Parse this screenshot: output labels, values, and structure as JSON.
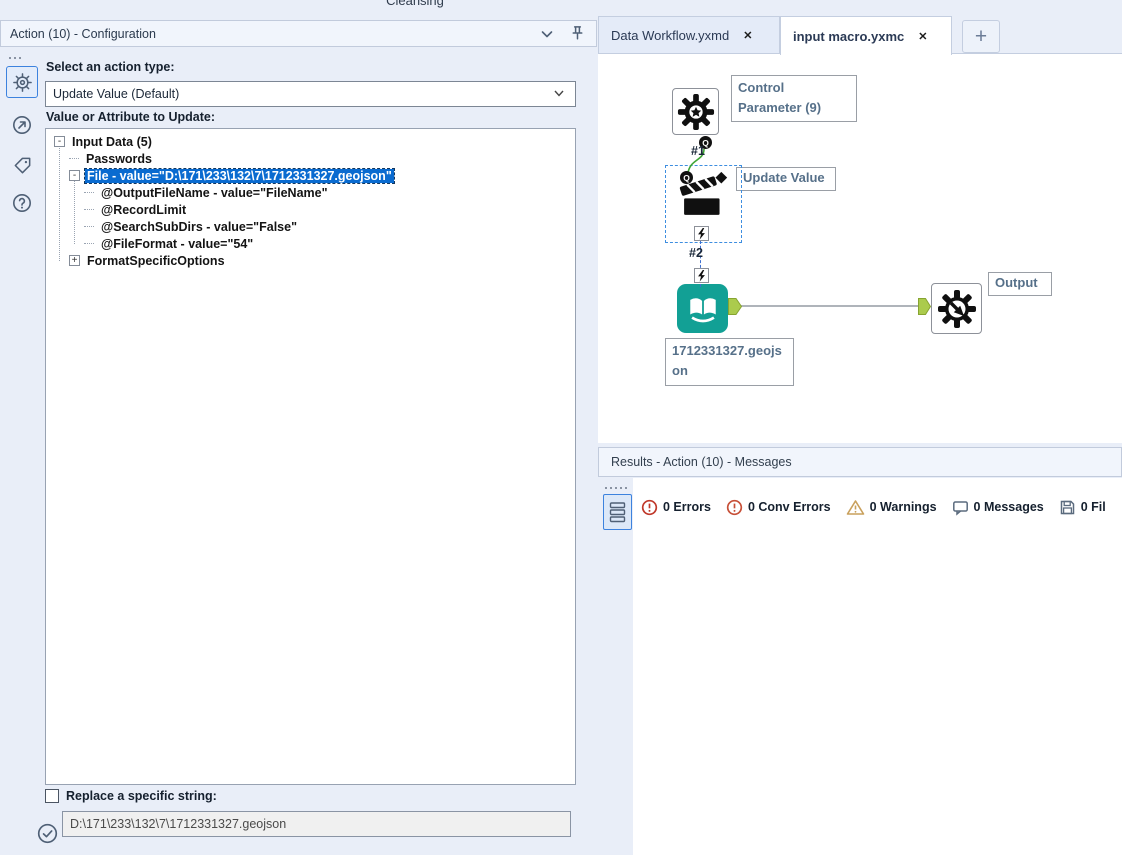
{
  "ribbon": {
    "category_label": "Cleansing"
  },
  "config_panel": {
    "title": "Action (10) - Configuration",
    "action_type_label": "Select an action type:",
    "action_type_value": "Update Value (Default)",
    "tree_label": "Value or Attribute to Update:",
    "tree_items": [
      {
        "text": "Input Data (5)",
        "level": 0,
        "expander": "minus",
        "selected": false
      },
      {
        "text": "Passwords",
        "level": 1,
        "expander": "none",
        "selected": false
      },
      {
        "text": "File - value=\"D:\\171\\233\\132\\7\\1712331327.geojson\"",
        "level": 1,
        "expander": "minus",
        "selected": true
      },
      {
        "text": "@OutputFileName - value=\"FileName\"",
        "level": 2,
        "expander": "none",
        "selected": false
      },
      {
        "text": "@RecordLimit",
        "level": 2,
        "expander": "none",
        "selected": false
      },
      {
        "text": "@SearchSubDirs - value=\"False\"",
        "level": 2,
        "expander": "none",
        "selected": false
      },
      {
        "text": "@FileFormat - value=\"54\"",
        "level": 2,
        "expander": "none",
        "selected": false
      },
      {
        "text": "FormatSpecificOptions",
        "level": 1,
        "expander": "plus",
        "selected": false
      }
    ],
    "replace_label": "Replace a specific string:",
    "replace_checked": false,
    "replace_value": "D:\\171\\233\\132\\7\\1712331327.geojson"
  },
  "document_tabs": {
    "tabs": [
      {
        "label": "Data Workflow.yxmd",
        "active": false
      },
      {
        "label": "input macro.yxmc",
        "active": true
      }
    ],
    "close_glyph": "✕",
    "new_tab_glyph": "+"
  },
  "canvas": {
    "q_badge": "Q",
    "connection_labels": {
      "first": "#1",
      "second": "#2"
    },
    "tools": [
      {
        "type": "control-parameter",
        "annotation": "Control Parameter (9)"
      },
      {
        "type": "action",
        "annotation": "Update Value",
        "selected": true
      },
      {
        "type": "input-data",
        "annotation": "1712331327.geojson"
      },
      {
        "type": "macro-output",
        "annotation": "Output"
      }
    ]
  },
  "results_panel": {
    "title": "Results - Action (10) - Messages",
    "statuses": [
      {
        "icon": "error",
        "label": "0 Errors"
      },
      {
        "icon": "conv-error",
        "label": "0 Conv Errors"
      },
      {
        "icon": "warning",
        "label": "0 Warnings"
      },
      {
        "icon": "message",
        "label": "0 Messages"
      },
      {
        "icon": "file",
        "label": "0 Fil"
      }
    ]
  },
  "colors": {
    "selection_blue": "#0A6BD0",
    "tool_teal": "#12A095",
    "anchor_green": "#ABCB4D",
    "error_red": "#C0392B",
    "warning_amber": "#C9A05C"
  }
}
